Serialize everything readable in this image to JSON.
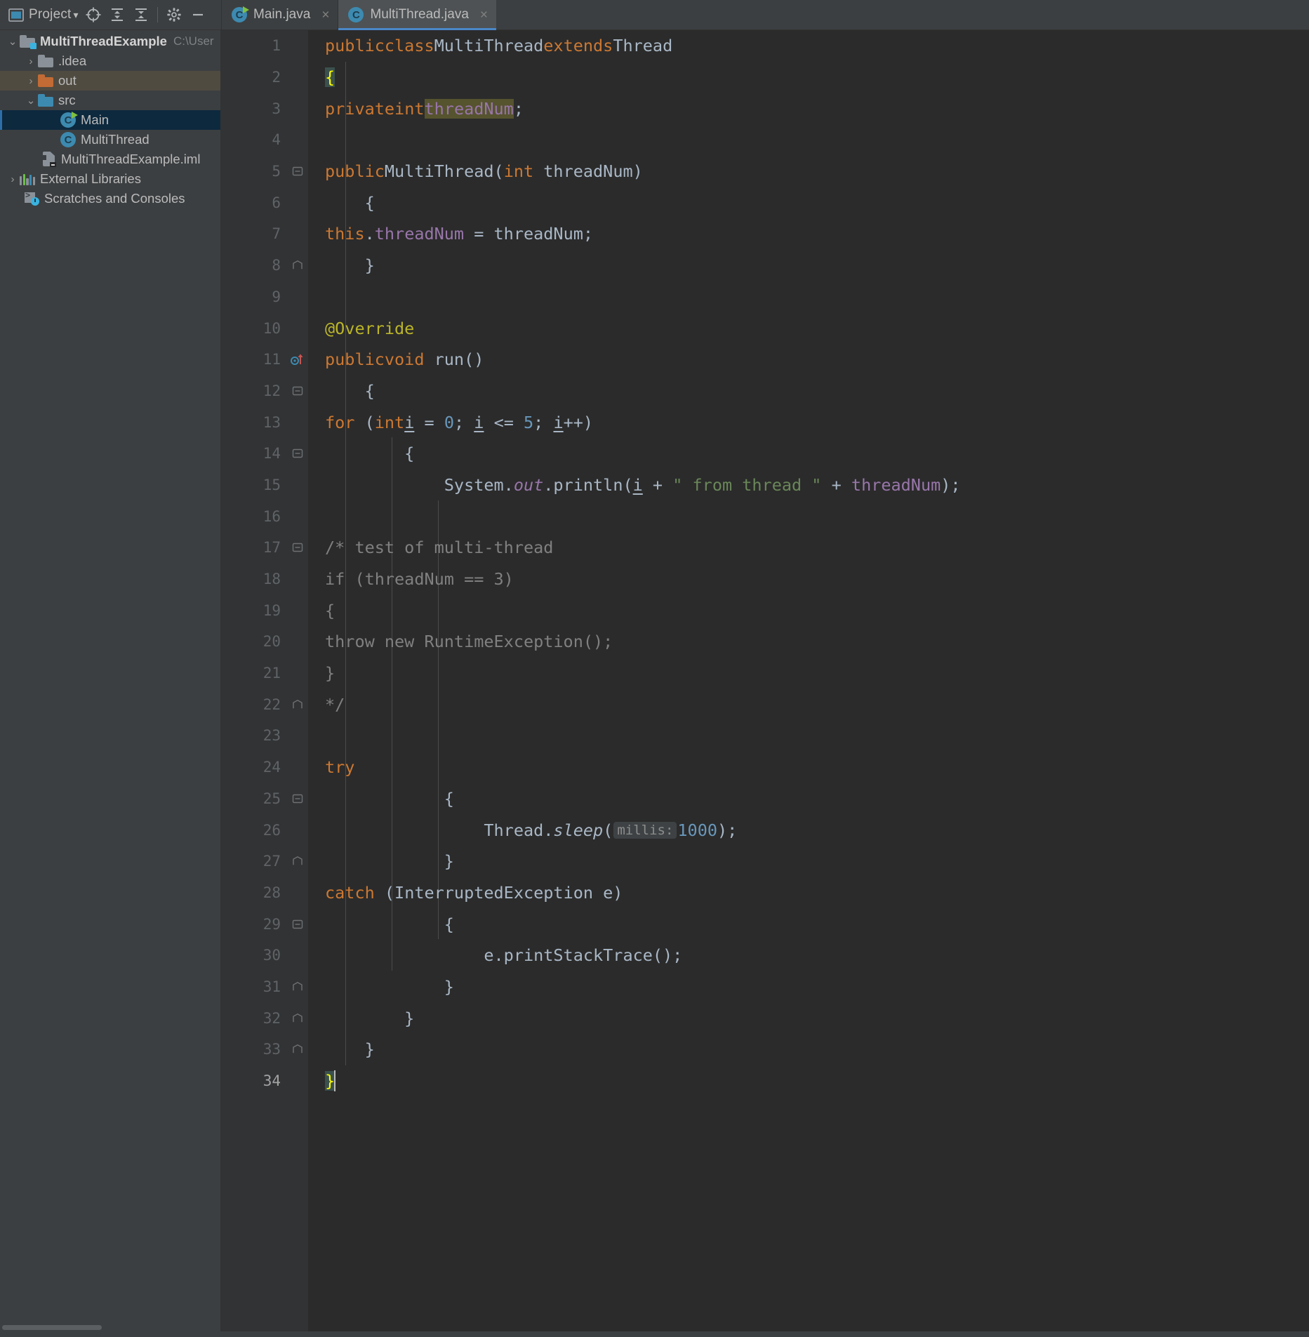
{
  "window": {
    "theme_bg": "#3c3f41",
    "editor_bg": "#2b2b2b",
    "accent": "#4a88c7"
  },
  "tool_window": {
    "title": "Project",
    "dropdown_caret": "▾",
    "buttons": [
      {
        "name": "locate-icon",
        "tooltip": "Select Opened File"
      },
      {
        "name": "expand-all-icon",
        "tooltip": "Expand All"
      },
      {
        "name": "collapse-all-icon",
        "tooltip": "Collapse All"
      },
      {
        "name": "gear-icon",
        "tooltip": "Settings"
      },
      {
        "name": "hide-icon",
        "tooltip": "Hide"
      }
    ]
  },
  "project_tree": {
    "nodes": [
      {
        "label": "MultiThreadExample",
        "path_suffix": "C:\\User",
        "icon": "project-folder-icon",
        "arrow": "⌄",
        "indent": 0,
        "bold": true,
        "state": "normal"
      },
      {
        "label": ".idea",
        "path_suffix": "",
        "icon": "folder-icon",
        "arrow": "›",
        "indent": 1,
        "bold": false,
        "state": "normal"
      },
      {
        "label": "out",
        "path_suffix": "",
        "icon": "folder-orange-icon",
        "arrow": "›",
        "indent": 1,
        "bold": false,
        "state": "amber"
      },
      {
        "label": "src",
        "path_suffix": "",
        "icon": "folder-blue-icon",
        "arrow": "⌄",
        "indent": 1,
        "bold": false,
        "state": "normal"
      },
      {
        "label": "Main",
        "path_suffix": "",
        "icon": "java-class-runnable-icon",
        "arrow": "",
        "indent": 2,
        "bold": false,
        "state": "selected"
      },
      {
        "label": "MultiThread",
        "path_suffix": "",
        "icon": "java-class-icon",
        "arrow": "",
        "indent": 2,
        "bold": false,
        "state": "normal"
      },
      {
        "label": "MultiThreadExample.iml",
        "path_suffix": "",
        "icon": "iml-file-icon",
        "arrow": "",
        "indent": 1,
        "bold": false,
        "state": "normal"
      },
      {
        "label": "External Libraries",
        "path_suffix": "",
        "icon": "external-libraries-icon",
        "arrow": "›",
        "indent": 0,
        "bold": false,
        "state": "normal"
      },
      {
        "label": "Scratches and Consoles",
        "path_suffix": "",
        "icon": "scratches-icon",
        "arrow": "",
        "indent": 0,
        "bold": false,
        "state": "normal"
      }
    ]
  },
  "editor_tabs": [
    {
      "label": "Main.java",
      "icon": "java-class-runnable-icon",
      "active": false,
      "close": "×"
    },
    {
      "label": "MultiThread.java",
      "icon": "java-class-icon",
      "active": true,
      "close": "×"
    }
  ],
  "editor": {
    "file": "MultiThread.java",
    "first_line": 1,
    "last_line": 34,
    "line_numbers": [
      1,
      2,
      3,
      4,
      5,
      6,
      7,
      8,
      9,
      10,
      11,
      12,
      13,
      14,
      15,
      16,
      17,
      18,
      19,
      20,
      21,
      22,
      23,
      24,
      25,
      26,
      27,
      28,
      29,
      30,
      31,
      32,
      33,
      34
    ],
    "current_line": 34,
    "gutter_markers": [
      {
        "line": 5,
        "type": "fold-open"
      },
      {
        "line": 8,
        "type": "fold-end"
      },
      {
        "line": 11,
        "type": "override-method-icon"
      },
      {
        "line": 12,
        "type": "fold-open"
      },
      {
        "line": 14,
        "type": "fold-open"
      },
      {
        "line": 17,
        "type": "fold-open"
      },
      {
        "line": 22,
        "type": "fold-end"
      },
      {
        "line": 25,
        "type": "fold-open"
      },
      {
        "line": 27,
        "type": "fold-end"
      },
      {
        "line": 29,
        "type": "fold-open"
      },
      {
        "line": 31,
        "type": "fold-end"
      },
      {
        "line": 32,
        "type": "fold-end"
      },
      {
        "line": 33,
        "type": "fold-end"
      }
    ],
    "parameter_hint": "millis:",
    "source_lines": [
      "public class MultiThread extends Thread",
      "{",
      "    private int threadNum;",
      "",
      "    public MultiThread(int threadNum)",
      "    {",
      "        this.threadNum = threadNum;",
      "    }",
      "",
      "    @Override",
      "    public void run()",
      "    {",
      "        for (int i = 0; i <= 5; i++)",
      "        {",
      "            System.out.println(i + \" from thread \" + threadNum);",
      "",
      "            /* test of multi-thread",
      "            if (threadNum == 3)",
      "            {",
      "                throw new RuntimeException();",
      "            }",
      "            */",
      "",
      "            try",
      "            {",
      "                Thread.sleep( millis: 1000);",
      "            }",
      "            catch (InterruptedException e)",
      "            {",
      "                e.printStackTrace();",
      "            }",
      "        }",
      "    }",
      "}"
    ]
  },
  "syntax_colors": {
    "keyword": "#cc7832",
    "string": "#6a8759",
    "number": "#6897bb",
    "field": "#9876aa",
    "annotation": "#bbb529",
    "comment": "#808080",
    "default": "#a9b7c6",
    "brace_match_bg": "#3b514d",
    "identifier_highlight_bg": "#56532f"
  }
}
